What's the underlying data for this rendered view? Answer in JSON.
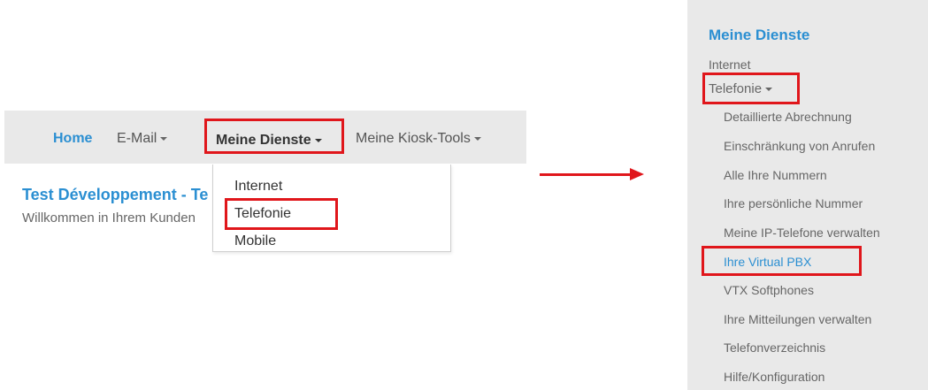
{
  "navbar": {
    "home": "Home",
    "email": "E-Mail",
    "meine_dienste": "Meine Dienste",
    "kiosk_tools": "Meine Kiosk-Tools"
  },
  "dropdown": {
    "items": [
      "Internet",
      "Telefonie",
      "Mobile"
    ]
  },
  "page": {
    "title": "Test Développement - Te",
    "subtitle": "Willkommen in Ihrem Kunden"
  },
  "sidebar": {
    "title": "Meine Dienste",
    "internet": "Internet",
    "telefonie": "Telefonie",
    "sub_items": [
      "Detaillierte Abrechnung",
      "Einschränkung von Anrufen",
      "Alle Ihre Nummern",
      "Ihre persönliche Nummer",
      "Meine IP-Telefone verwalten",
      "Ihre Virtual PBX",
      "VTX Softphones",
      "Ihre Mitteilungen verwalten",
      "Telefonverzeichnis",
      "Hilfe/Konfiguration"
    ],
    "active_index": 5
  },
  "colors": {
    "accent": "#2b8fd2",
    "highlight": "#e0161b",
    "nav_bg": "#e9e9e9"
  }
}
